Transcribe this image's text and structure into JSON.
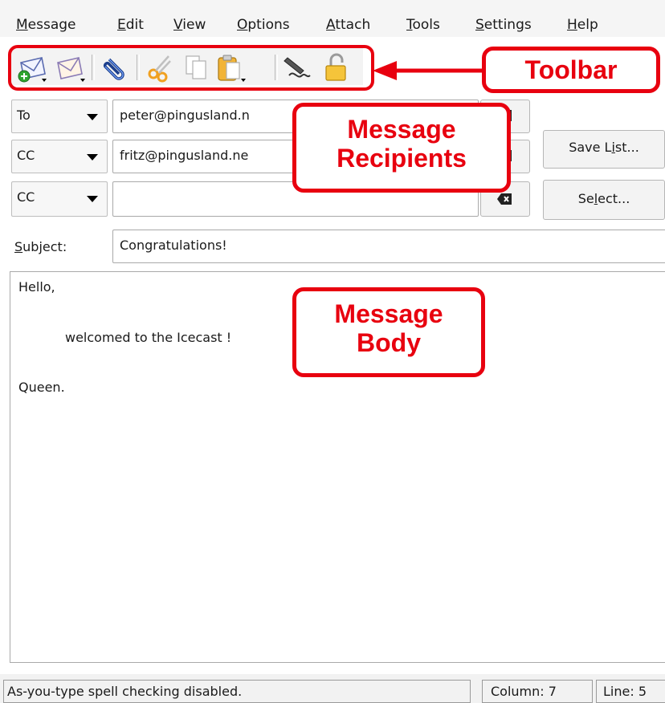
{
  "menu": [
    {
      "first": "M",
      "rest": "essage"
    },
    {
      "first": "E",
      "rest": "dit"
    },
    {
      "first": "V",
      "rest": "iew"
    },
    {
      "first": "O",
      "rest": "ptions"
    },
    {
      "first": "A",
      "rest": "ttach"
    },
    {
      "first": "T",
      "rest": "ools"
    },
    {
      "first": "S",
      "rest": "ettings"
    },
    {
      "first": "H",
      "rest": "elp"
    }
  ],
  "toolbar": {
    "icons": [
      "send-mail-icon",
      "queue-mail-icon",
      "attach-icon",
      "cut-icon",
      "copy-icon",
      "paste-icon",
      "sign-icon",
      "encrypt-icon"
    ]
  },
  "recipients": [
    {
      "type": "To",
      "value": "peter@pingusland.n"
    },
    {
      "type": "CC",
      "value": "fritz@pingusland.ne"
    },
    {
      "type": "CC",
      "value": ""
    }
  ],
  "buttons": {
    "save_list_pre": "Save L",
    "save_list_u": "i",
    "save_list_post": "st...",
    "select_pre": "Se",
    "select_u": "l",
    "select_post": "ect..."
  },
  "subject": {
    "label_u": "S",
    "label_rest": "ubject:",
    "value": "Congratulations!"
  },
  "body": {
    "line1": "Hello,",
    "line2": "welcomed to the Icecast !",
    "line3": "Queen."
  },
  "status": {
    "message": "As-you-type spell checking disabled.",
    "column": "Column: 7",
    "line": "Line: 5"
  },
  "annotations": {
    "toolbar": "Toolbar",
    "recipients_1": "Message",
    "recipients_2": "Recipients",
    "body_1": "Message",
    "body_2": "Body"
  },
  "colors": {
    "annotation": "#e8000f"
  }
}
